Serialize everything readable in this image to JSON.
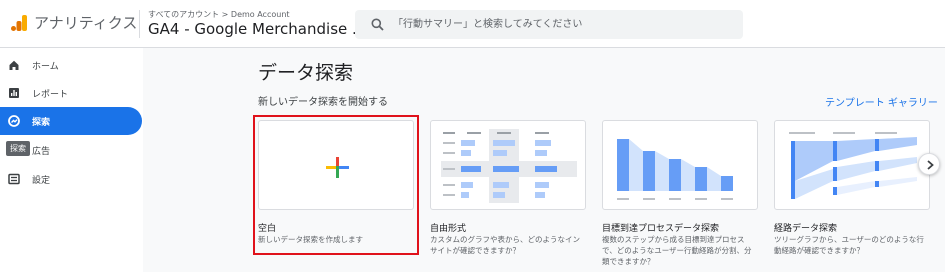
{
  "header": {
    "app_name": "アナリティクス",
    "account_breadcrumb": "すべてのアカウント > Demo Account",
    "property_name": "GA4 - Google Merchandise ...",
    "property_caret": "▾",
    "search_placeholder": "「行動サマリー」と検索してみてください"
  },
  "sidebar": {
    "items": [
      {
        "label": "ホーム",
        "icon": "home-icon"
      },
      {
        "label": "レポート",
        "icon": "reports-icon"
      },
      {
        "label": "探索",
        "icon": "explore-icon",
        "active": true
      },
      {
        "label": "広告",
        "icon": "advertising-icon"
      },
      {
        "label": "設定",
        "icon": "configure-icon"
      }
    ],
    "tooltip": "探索"
  },
  "main": {
    "title": "データ探索",
    "section_label": "新しいデータ探索を開始する",
    "gallery_link": "テンプレート ギャラリー",
    "cards": [
      {
        "title": "空白",
        "description": "新しいデータ探索を作成します"
      },
      {
        "title": "自由形式",
        "description": "カスタムのグラフや表から、どのようなインサイトが確認できますか？"
      },
      {
        "title": "目標到達プロセスデータ探索",
        "description": "複数のステップから成る目標到達プロセスで、どのようなユーザー行動経路が分割、分類できますか？"
      },
      {
        "title": "経路データ探索",
        "description": "ツリーグラフから、ユーザーのどのような行動経路が確認できますか？"
      }
    ]
  },
  "colors": {
    "accent": "#1a73e8",
    "selection_outline": "#e0121b",
    "plus_red": "#ea4335",
    "plus_yellow": "#fbbc04",
    "plus_green": "#34a853",
    "plus_blue": "#4285f4"
  }
}
